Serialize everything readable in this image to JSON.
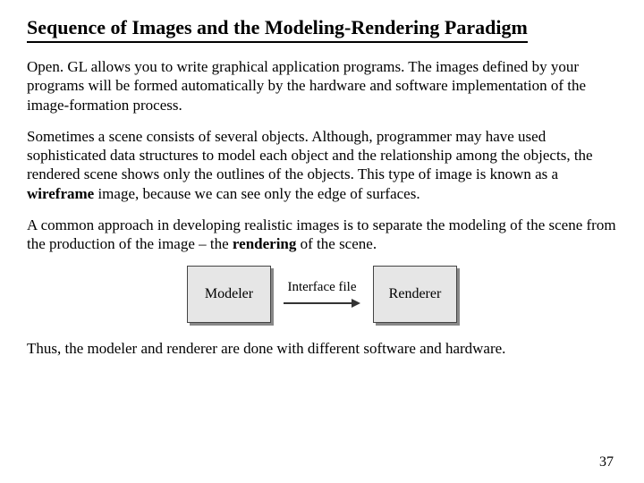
{
  "title": "Sequence of Images and the Modeling-Rendering Paradigm",
  "p1_a": "Open. GL allows you to write graphical application programs.  The images defined by your programs will be formed automatically by the hardware and software implementation of the image-formation process.",
  "p2_a": "Sometimes a scene consists of several objects.  Although, programmer may have used sophisticated data structures to model each object and the relationship among the objects, the rendered scene shows only the outlines of the objects. This type of image is known as a ",
  "p2_bold": "wireframe",
  "p2_b": " image, because we can see only the edge of surfaces.",
  "p3_a": "A common approach in developing realistic images is to separate the modeling of the scene from the production of the image – the ",
  "p3_bold": "rendering",
  "p3_b": " of the scene.",
  "diagram": {
    "modeler": "Modeler",
    "interface": "Interface file",
    "renderer": "Renderer"
  },
  "p4": "Thus, the modeler and renderer are done with different software and hardware.",
  "pagenum": "37"
}
